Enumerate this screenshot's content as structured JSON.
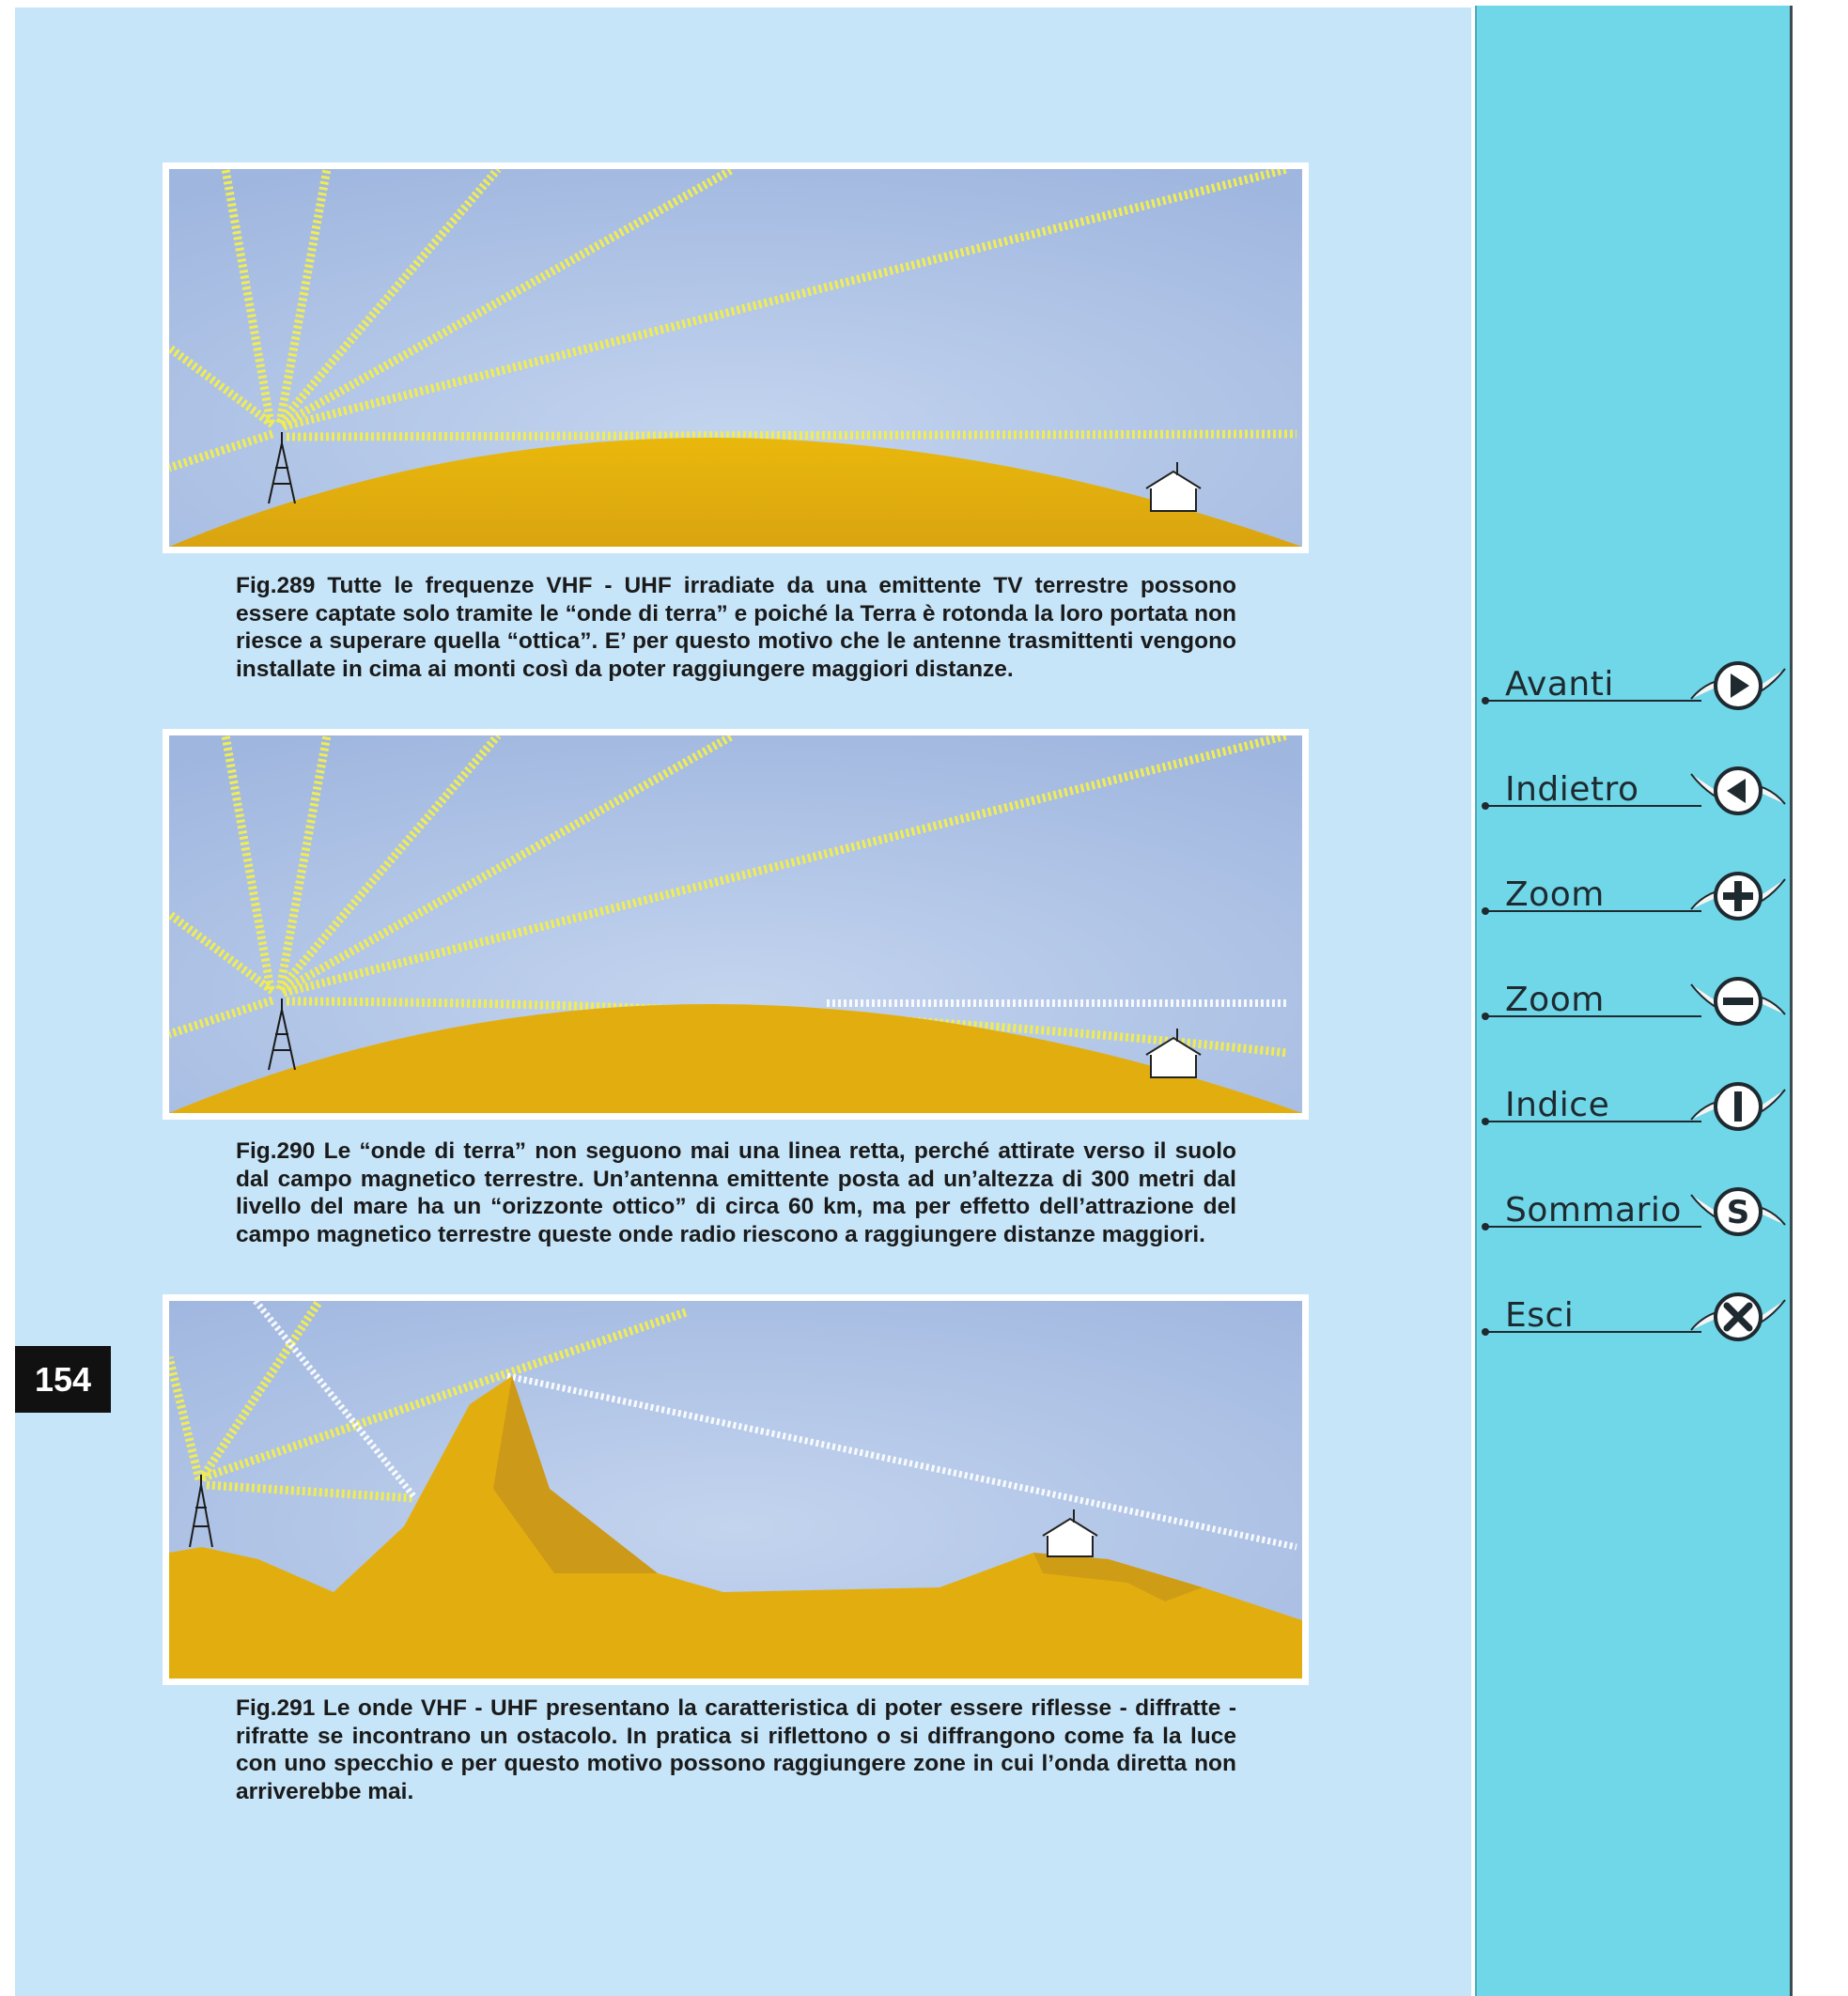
{
  "page_number": "154",
  "figures": [
    {
      "caption": "Fig.289 Tutte le frequenze VHF - UHF irradiate da una emittente TV terrestre possono essere captate solo tramite le “onde di terra” e poiché la Terra è rotonda la loro portata non riesce a superare quella “ottica”. E’ per questo motivo che le antenne trasmittenti vengono installate in cima ai monti così da poter raggiungere maggiori distanze."
    },
    {
      "caption": "Fig.290 Le “onde di terra” non seguono mai una linea retta, perché attirate verso il suolo dal campo magnetico terrestre. Un’antenna emittente posta ad un’altezza di 300 metri dal livello del mare ha un “orizzonte ottico” di circa 60 km, ma per effetto dell’attrazione del campo magnetico terrestre queste onde radio riescono a raggiungere distanze maggiori."
    },
    {
      "caption": "Fig.291 Le onde VHF - UHF presentano la caratteristica di poter essere riflesse - diffratte - rifratte se incontrano un ostacolo. In pratica si riflettono o si diffrangono come fa la luce con uno specchio e per questo motivo possono raggiungere zone in cui l’onda diretta non arriverebbe mai."
    }
  ],
  "nav": [
    {
      "label": "Avanti",
      "icon": "play-right-icon"
    },
    {
      "label": "Indietro",
      "icon": "play-left-icon"
    },
    {
      "label": "Zoom",
      "icon": "plus-icon"
    },
    {
      "label": "Zoom",
      "icon": "minus-icon"
    },
    {
      "label": "Indice",
      "icon": "index-i-icon"
    },
    {
      "label": "Sommario",
      "icon": "summary-s-icon"
    },
    {
      "label": "Esci",
      "icon": "exit-x-icon"
    }
  ],
  "colors": {
    "page_bg": "#c6e5f9",
    "sidebar_bg": "#70d7e8",
    "sky": "#b3c8e8",
    "earth": "#e2ae0f",
    "wave": "#f4ef4c"
  }
}
